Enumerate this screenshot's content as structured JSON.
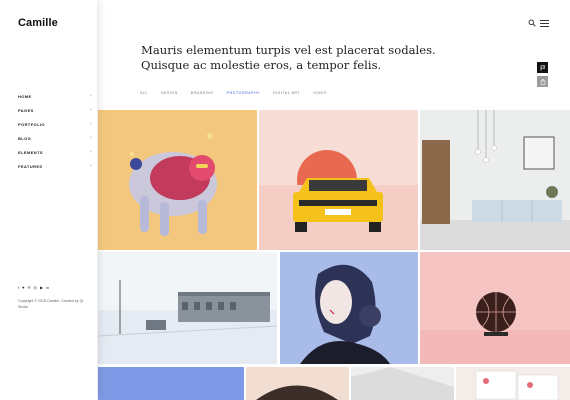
{
  "brand": "Camille",
  "nav": [
    {
      "label": "HOME"
    },
    {
      "label": "PAGES"
    },
    {
      "label": "PORTFOLIO"
    },
    {
      "label": "BLOG"
    },
    {
      "label": "ELEMENTS"
    },
    {
      "label": "FEATURES"
    }
  ],
  "nav_chevron": "›",
  "social_icons": [
    "facebook-icon",
    "twitter-icon",
    "pinterest-icon",
    "instagram-icon",
    "youtube-icon",
    "linkedin-icon"
  ],
  "copyright": "Copyright © 2018 Camille. Created by Qi Studio",
  "headline": "Mauris elementum turpis vel est placerat sodales. Quisque ac molestie eros, a tempor felis.",
  "filters": {
    "items": [
      "ALL",
      "DESIGN",
      "BRANDING",
      "PHOTOGRAPHY",
      "DIGITAL ART",
      "VIDEO"
    ],
    "active": "PHOTOGRAPHY"
  },
  "colors": {
    "accent": "#3b5bdb",
    "tile_yellow": "#f4c77e",
    "tile_pink": "#f6ddd5",
    "tile_blue": "#a9bbe9",
    "tile_rose": "#f6c4c3"
  }
}
